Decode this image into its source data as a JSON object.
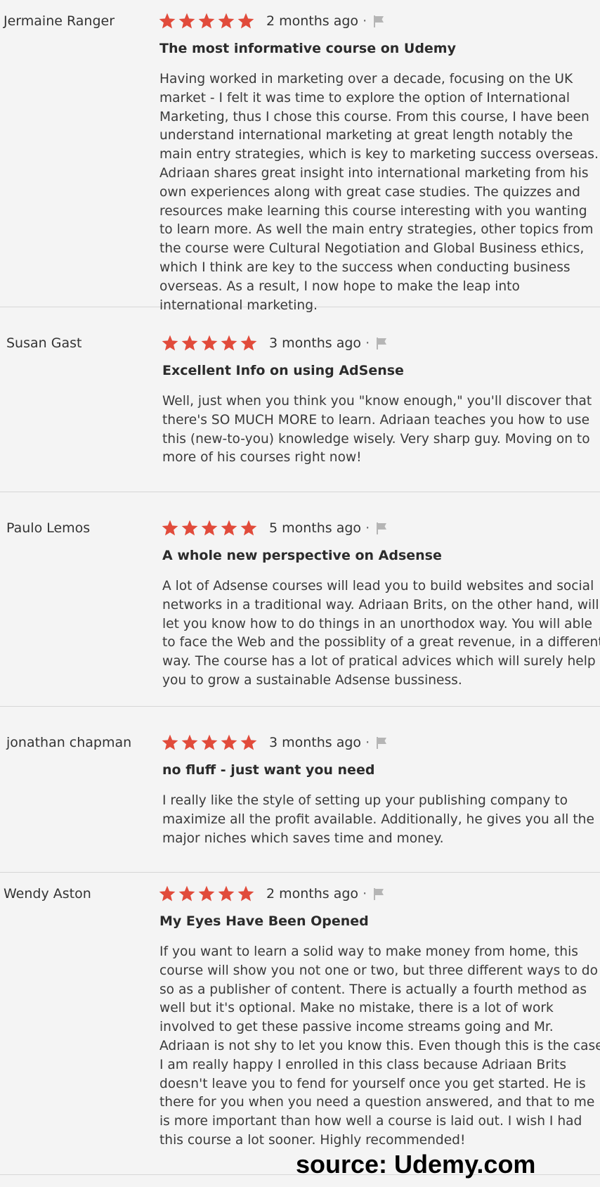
{
  "colors": {
    "star": "#e14b3b",
    "flag": "#b5b5b5",
    "background": "#f4f4f4",
    "divider": "#d6d6d6"
  },
  "icons": {
    "rating": "star-icon",
    "report": "flag-icon"
  },
  "reviews": [
    {
      "reviewer": "Jermaine Ranger",
      "rating": 5,
      "date": "2 months ago",
      "separator": "·",
      "title": "The most informative course on Udemy",
      "body": "Having worked in marketing over a decade, focusing on the UK market - I felt it was time to explore the option of International Marketing, thus I chose this course. From this course, I have been understand international marketing at great length notably the main entry strategies, which is key to marketing success overseas. Adriaan shares great insight into international marketing from his own experiences along with great case studies. The quizzes and resources make learning this course interesting with you wanting to learn more. As well the main entry strategies, other topics from the course were Cultural Negotiation and Global Business ethics, which I think are key to the success when conducting business overseas. As a result, I now hope to make the leap into international marketing."
    },
    {
      "reviewer": "Susan Gast",
      "rating": 5,
      "date": "3 months ago",
      "separator": "·",
      "title": "Excellent Info on using AdSense",
      "body": "Well, just when you think you \"know enough,\" you'll discover that there's SO MUCH MORE to learn. Adriaan teaches you how to use this (new-to-you) knowledge wisely. Very sharp guy. Moving on to more of his courses right now!"
    },
    {
      "reviewer": "Paulo Lemos",
      "rating": 5,
      "date": "5 months ago",
      "separator": "·",
      "title": "A whole new perspective on Adsense",
      "body": "A lot of Adsense courses will lead you to build websites and social networks in a traditional way. Adriaan Brits, on the other hand, will let you know how to do things in an unorthodox way. You will able to face the Web and the possiblity of a great revenue, in a different way. The course has a lot of pratical advices which will surely help you to grow a sustainable Adsense bussiness."
    },
    {
      "reviewer": "jonathan chapman",
      "rating": 5,
      "date": "3 months ago",
      "separator": "·",
      "title": "no fluff - just want you need",
      "body": "I really like the style of setting up your publishing company to maximize all the profit available. Additionally, he gives you all the major niches which saves time and money."
    },
    {
      "reviewer": "Wendy Aston",
      "rating": 5,
      "date": "2 months ago",
      "separator": "·",
      "title": "My Eyes Have Been Opened",
      "body": "If you want to learn a solid way to make money from home, this course will show you not one or two, but three different ways to do so as a publisher of content. There is actually a fourth method as well but it's optional. Make no mistake, there is a lot of work involved to get these passive income streams going and Mr. Adriaan is not shy to let you know this. Even though this is the case I am really happy I enrolled in this class because Adriaan Brits doesn't leave you to fend for yourself once you get started. He is there for you when you need a question answered, and that to me is more important than how well a course is laid out. I wish I had this course a lot sooner. Highly recommended!"
    }
  ],
  "source_note": "source: Udemy.com"
}
